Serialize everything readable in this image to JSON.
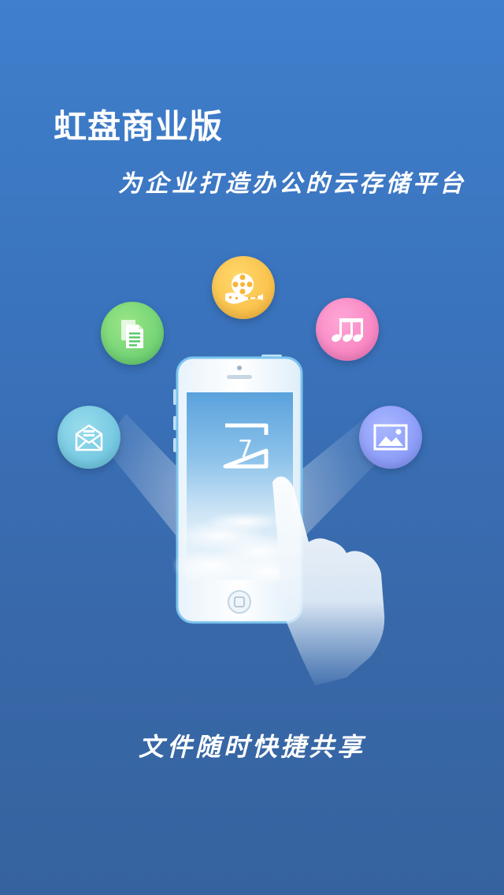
{
  "splash": {
    "app_title": "虹盘商业版",
    "tagline": "为企业打造办公的云存储平台",
    "footer": "文件随时快捷共享"
  },
  "phone": {
    "logo_glyph": "7"
  },
  "icons": [
    {
      "name": "mail-icon",
      "color": "#62bedc"
    },
    {
      "name": "document-icon",
      "color": "#5cc86a"
    },
    {
      "name": "film-reel-icon",
      "color": "#f8b53a"
    },
    {
      "name": "music-note-icon",
      "color": "#f474b8"
    },
    {
      "name": "image-icon",
      "color": "#7d8ef4"
    }
  ],
  "colors": {
    "background_top": "#3f7fcc",
    "background_bottom": "#36639f",
    "text": "#ffffff"
  }
}
